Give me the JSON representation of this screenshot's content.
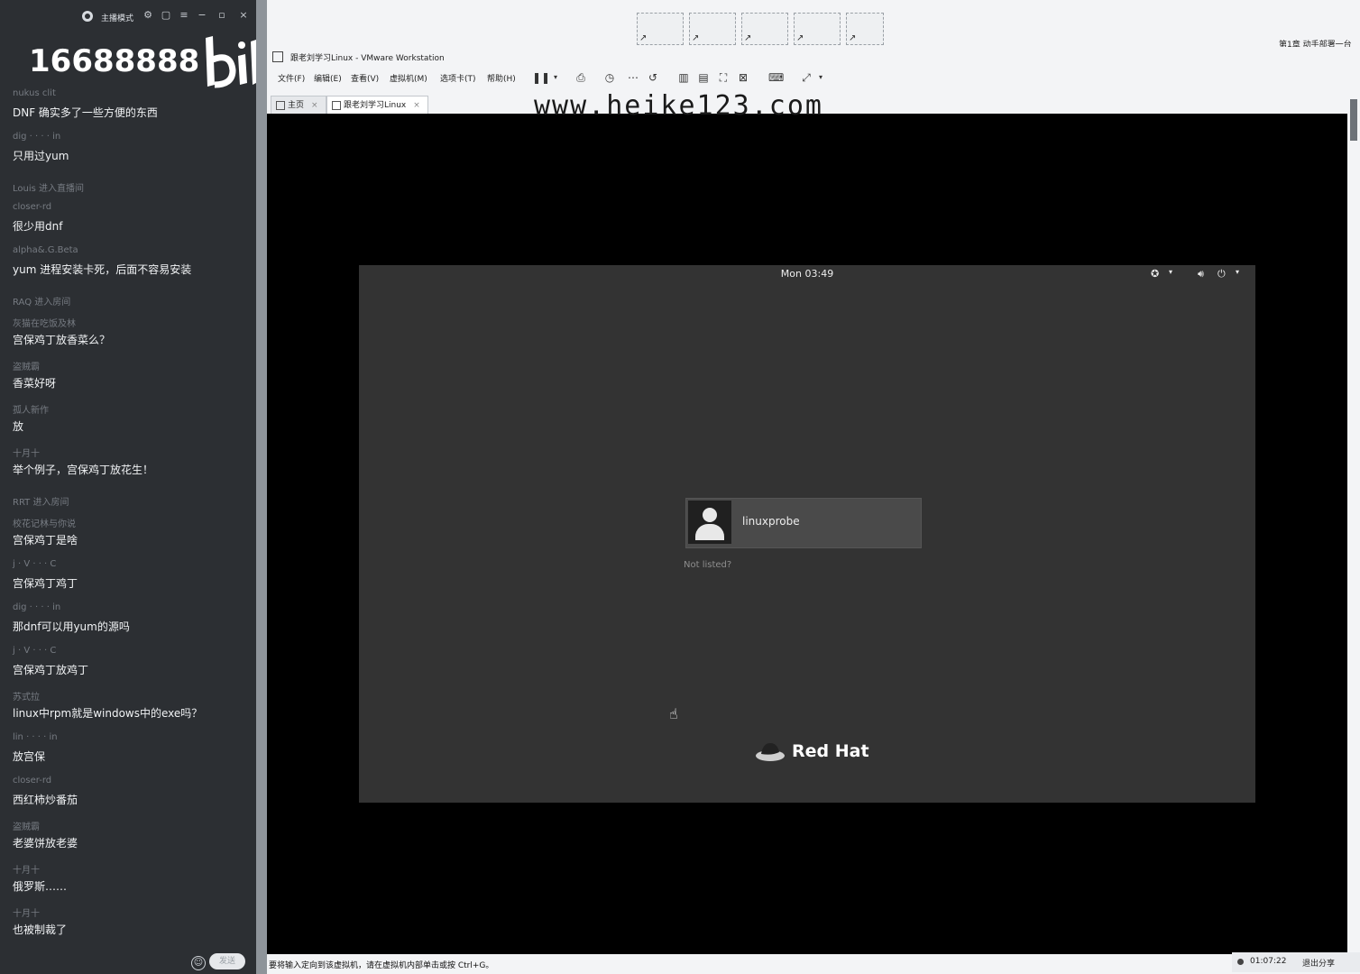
{
  "chat": {
    "mode_label": "主播模式",
    "big_number": "16688888",
    "brand_wordmark": "bilibili",
    "messages": [
      {
        "user": "nukus clit",
        "text": "DNF 确实多了一些方便的东西"
      },
      {
        "user": "dig  ·  ·  ·  ·  in",
        "text": "只用过yum"
      },
      {
        "user": "Louis 进入直播间",
        "text": ""
      },
      {
        "user": "closer-rd",
        "text": "很少用dnf"
      },
      {
        "user": "alpha&.G.Beta",
        "text": "yum 进程安装卡死，后面不容易安装"
      },
      {
        "user": "RAQ 进入房间",
        "text": ""
      },
      {
        "user": "灰猫在吃饭及林",
        "text": "宫保鸡丁放香菜么？"
      },
      {
        "user": "盗贼霸",
        "text": "香菜好呀"
      },
      {
        "user": "孤人新作",
        "text": "放"
      },
      {
        "user": "十月十",
        "text": "举个例子，宫保鸡丁放花生！"
      },
      {
        "user": "RRT 进入房间",
        "text": ""
      },
      {
        "user": "校花记林与你说",
        "text": "宫保鸡丁是啥"
      },
      {
        "user": "j  ·  V  ·  ·  ·  C",
        "text": "宫保鸡丁鸡丁"
      },
      {
        "user": "dig  ·  ·  ·  ·  in",
        "text": "那dnf可以用yum的源吗"
      },
      {
        "user": "j  ·  V  ·  ·  ·  C",
        "text": "宫保鸡丁放鸡丁"
      },
      {
        "user": "苏式拉",
        "text": "linux中rpm就是windows中的exe吗？"
      },
      {
        "user": "lin  ·  ·  ·  ·  in",
        "text": "放宫保"
      },
      {
        "user": "closer-rd",
        "text": "西红柿炒番茄"
      },
      {
        "user": "盗贼霸",
        "text": "老婆饼放老婆"
      },
      {
        "user": "十月十",
        "text": "俄罗斯……"
      },
      {
        "user": "十月十",
        "text": "也被制裁了"
      }
    ],
    "send_label": "发送"
  },
  "vmware": {
    "window_title": "跟老刘学习Linux - VMware Workstation",
    "menus": [
      "文件(F)",
      "编辑(E)",
      "查看(V)",
      "虚拟机(M)",
      "选项卡(T)",
      "帮助(H)"
    ],
    "tabs": [
      {
        "label": "主页"
      },
      {
        "label": "跟老刘学习Linux"
      }
    ],
    "watermark": "www.heike123.com",
    "status_text": "要将输入定向到该虚拟机，请在虚拟机内部单击或按 Ctrl+G。",
    "share_title": "第1章 动手部署一台",
    "rec_time": "01:07:22",
    "exit_share": "退出分享"
  },
  "guest": {
    "clock": "Mon 03:49",
    "username": "linuxprobe",
    "not_listed": "Not listed?",
    "brand": "Red Hat"
  }
}
